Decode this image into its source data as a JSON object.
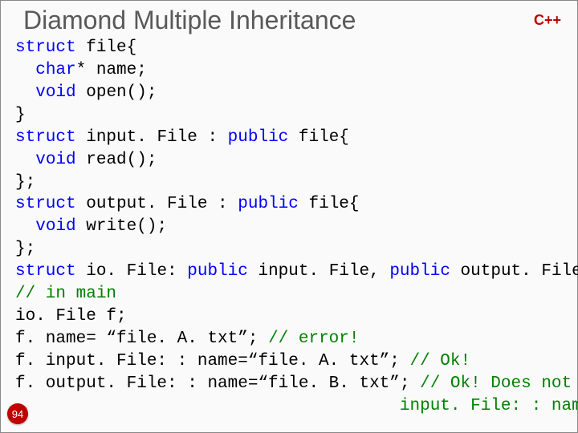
{
  "title": "Diamond Multiple Inheritance",
  "lang_badge": "C++",
  "page_number": "94",
  "code_lines": [
    [
      {
        "t": "struct",
        "c": "k"
      },
      {
        "t": " file{",
        "c": ""
      }
    ],
    [
      {
        "t": "  ",
        "c": ""
      },
      {
        "t": "char",
        "c": "k"
      },
      {
        "t": "* name;",
        "c": ""
      }
    ],
    [
      {
        "t": "  ",
        "c": ""
      },
      {
        "t": "void",
        "c": "k"
      },
      {
        "t": " open();",
        "c": ""
      }
    ],
    [
      {
        "t": "}",
        "c": ""
      }
    ],
    [
      {
        "t": "struct",
        "c": "k"
      },
      {
        "t": " input. File : ",
        "c": ""
      },
      {
        "t": "public",
        "c": "k"
      },
      {
        "t": " file{",
        "c": ""
      }
    ],
    [
      {
        "t": "  ",
        "c": ""
      },
      {
        "t": "void",
        "c": "k"
      },
      {
        "t": " read();",
        "c": ""
      }
    ],
    [
      {
        "t": "};",
        "c": ""
      }
    ],
    [
      {
        "t": "struct",
        "c": "k"
      },
      {
        "t": " output. File : ",
        "c": ""
      },
      {
        "t": "public",
        "c": "k"
      },
      {
        "t": " file{",
        "c": ""
      }
    ],
    [
      {
        "t": "  ",
        "c": ""
      },
      {
        "t": "void",
        "c": "k"
      },
      {
        "t": " write();",
        "c": ""
      }
    ],
    [
      {
        "t": "};",
        "c": ""
      }
    ],
    [
      {
        "t": "struct",
        "c": "k"
      },
      {
        "t": " io. File: ",
        "c": ""
      },
      {
        "t": "public",
        "c": "k"
      },
      {
        "t": " input. File, ",
        "c": ""
      },
      {
        "t": "public",
        "c": "k"
      },
      {
        "t": " output. File{};",
        "c": ""
      }
    ],
    [
      {
        "t": "// in main",
        "c": "c"
      }
    ],
    [
      {
        "t": "io. File f;",
        "c": ""
      }
    ],
    [
      {
        "t": "f. name= “file. A. txt”; ",
        "c": ""
      },
      {
        "t": "// error!",
        "c": "c"
      }
    ],
    [
      {
        "t": "f. input. File: : name=“file. A. txt”; ",
        "c": ""
      },
      {
        "t": "// Ok!",
        "c": "c"
      }
    ],
    [
      {
        "t": "f. output. File: : name=“file. B. txt”; ",
        "c": ""
      },
      {
        "t": "// Ok! Does not change",
        "c": "c"
      }
    ],
    [
      {
        "t": "                                      ",
        "c": ""
      },
      {
        "t": "input. File: : name",
        "c": "c"
      }
    ]
  ]
}
